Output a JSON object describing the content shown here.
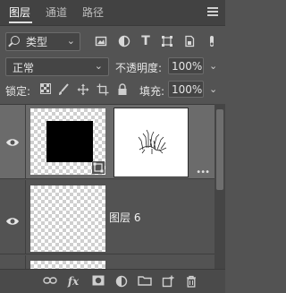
{
  "tabs": [
    {
      "label": "图层"
    },
    {
      "label": "通道"
    },
    {
      "label": "路径"
    }
  ],
  "filter": {
    "kind_label": "类型",
    "icons": [
      "image-filter-icon",
      "adjustment-filter-icon",
      "type-filter-icon",
      "shape-filter-icon",
      "smart-object-filter-icon",
      "filter-toggle-icon"
    ]
  },
  "blend": {
    "mode": "正常",
    "opacity_label": "不透明度:",
    "opacity_value": "100%"
  },
  "lock": {
    "label": "锁定:",
    "fill_label": "填充:",
    "fill_value": "100%"
  },
  "layers": [
    {
      "name": "",
      "selected": true,
      "has_mask": true
    },
    {
      "name": "图层 6",
      "selected": false,
      "has_mask": false
    }
  ],
  "bottom_toolbar": {
    "fx_label": "fx"
  },
  "colors": {
    "panel_bg": "#535353",
    "selected_row": "#6b6b6b",
    "text": "#e6e6e6"
  }
}
